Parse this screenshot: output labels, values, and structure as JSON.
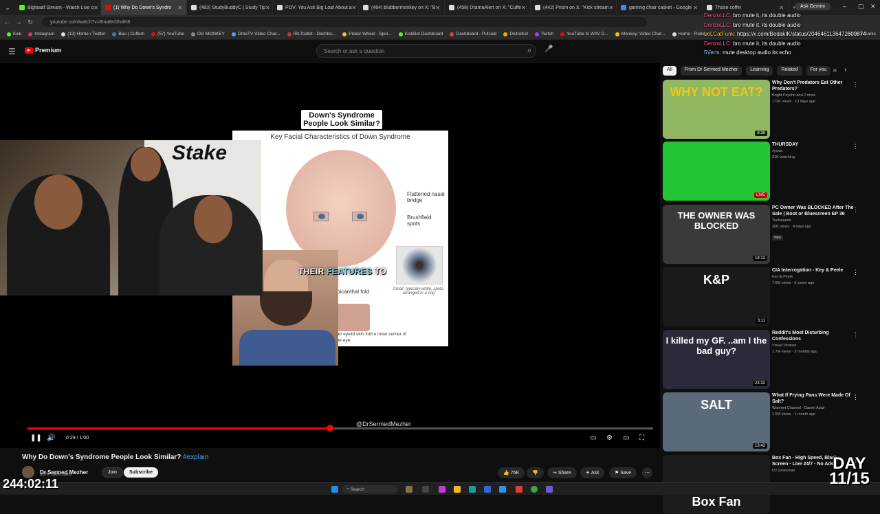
{
  "browser": {
    "tabs": [
      {
        "title": "Bigloaaf Stream - Watch Live o",
        "color": "#53fc18",
        "active": false
      },
      {
        "title": "(1) Why Do Down's Syndro",
        "color": "#ff0000",
        "active": true
      },
      {
        "title": "(483) StudyBuddyC | Study Tip",
        "color": "#dddddd",
        "active": false
      },
      {
        "title": "POV: You Ask Big Loaf About a",
        "color": "#dddddd",
        "active": false
      },
      {
        "title": "(464) blubbermonkey on X: \"B",
        "color": "#dddddd",
        "active": false
      },
      {
        "title": "(458) DramaAlert on X: \"Cuffe",
        "color": "#dddddd",
        "active": false
      },
      {
        "title": "(442) Prism on X: \"Kick stream",
        "color": "#dddddd",
        "active": false
      },
      {
        "title": "gaming chair casket - Google",
        "color": "#4285f4",
        "active": false
      },
      {
        "title": "Those coffin",
        "color": "#dddddd",
        "active": false
      }
    ],
    "ask_gemini": "Ask Gemini",
    "url": "youtube.com/watch?v=8ma8nDhnlK8",
    "bookmarks": [
      {
        "label": "Kick",
        "color": "#53fc18"
      },
      {
        "label": "Instagram",
        "color": "#e1306c"
      },
      {
        "label": "(12) Home / Twitter",
        "color": "#dddddd"
      },
      {
        "label": "Bau | Cuffem",
        "color": "#3a7bd5"
      },
      {
        "label": "(57) YouTube",
        "color": "#ff0000"
      },
      {
        "label": "OG MONKEY",
        "color": "#888888"
      },
      {
        "label": "OmeTV Video Chat...",
        "color": "#4aa3ff"
      },
      {
        "label": "IRLToolkit - Dashbo...",
        "color": "#cc3333"
      },
      {
        "label": "Picker Wheel - Spin...",
        "color": "#f5c518"
      },
      {
        "label": "KickBot Dashboard",
        "color": "#53fc18"
      },
      {
        "label": "Dashboard - Pulsoid",
        "color": "#e14040"
      },
      {
        "label": "DistroKid",
        "color": "#ffaa00"
      },
      {
        "label": "Twitch",
        "color": "#9146ff"
      },
      {
        "label": "YouTube to WAV D...",
        "color": "#ff0000"
      },
      {
        "label": "Monkey: Video Chat...",
        "color": "#f5c518"
      },
      {
        "label": "Home - Roblox",
        "color": "#dddddd"
      }
    ],
    "all_bookmarks": "All Bookmarks"
  },
  "youtube": {
    "logo": "Premium",
    "search_placeholder": "Search or ask a question"
  },
  "video": {
    "headline": "Down's Syndrome People Look Similar?",
    "card_subtitle": "Key Facial Characteristics of Down Syndrome",
    "labels": {
      "nasal": "Flattened nasal bridge",
      "brushfield": "Brushfield spots",
      "epicanthal": "picanthal fold",
      "iris_caption": "Small, typically white, spots, arranged in a ring",
      "eyelid": "per eyelid skin fold e inner corner of the eye."
    },
    "caption_white": "THEIR",
    "caption_highlight": "FEATURES",
    "caption_end": "TO",
    "handle": "@DrSermedMezher",
    "stake_logo": "Stake",
    "time": "0:29 / 1:00",
    "progress": 0.483,
    "title": "Why Do Down's Syndrome People Look Similar?",
    "hashtag": "#explain",
    "channel": "Dr Sermed Mezher",
    "subs": "867K subscribers",
    "join": "Join",
    "subscribe": "Subscribe",
    "likes": "76K",
    "share": "Share",
    "ask": "Ask",
    "save": "Save"
  },
  "chips": [
    "All",
    "From Dr Sermed Mezher",
    "Learning",
    "Related",
    "For you"
  ],
  "chip_overflow": "R",
  "recommendations": [
    {
      "title": "Why Don't Predators Eat Other Predators?",
      "channel": "Bright Psycho and 2 more",
      "meta": "172K views · 13 days ago",
      "duration": "9:39",
      "thumb_text": "WHY NOT EAT?",
      "bg": "#8fb860",
      "fg": "#f5c518"
    },
    {
      "title": "THURSDAY",
      "channel": "Jynxzi",
      "meta": "21K watching",
      "duration": "LIVE",
      "thumb_text": "",
      "bg": "#22c634",
      "fg": "#ffffff"
    },
    {
      "title": "PC Owner Was BLOCKED After The Sale | Boot or Bluescreen EP 36",
      "channel": "Techwando",
      "meta": "20K views · 4 days ago",
      "duration": "18:12",
      "thumb_text": "THE OWNER WAS BLOCKED",
      "bg": "#3a3a3a",
      "fg": "#ffffff",
      "badge": "New"
    },
    {
      "title": "CIA Interrogation - Key & Peele",
      "channel": "Key & Peele",
      "meta": "7.6M views · 5 years ago",
      "duration": "3:11",
      "thumb_text": "K&P",
      "bg": "#1a1a1a",
      "fg": "#ffffff"
    },
    {
      "title": "Reddit's Most Disturbing Confessions",
      "channel": "Visual Venture",
      "meta": "1.7M views · 3 months ago",
      "duration": "23:32",
      "thumb_text": "I killed my GF. ..am I the bad guy?",
      "bg": "#2a2a3a",
      "fg": "#ffffff"
    },
    {
      "title": "What If Frying Pans Were Made Of Salt?",
      "channel": "Waterjet Channel - Daniel Adair",
      "meta": "1.5M views · 1 month ago",
      "duration": "13:42",
      "thumb_text": "SALT",
      "bg": "#5a6a78",
      "fg": "#ffffff"
    },
    {
      "title": "Box Fan - High Speed, Black Screen · Live 24/7 · No Ads",
      "channel": "DJ Grossman",
      "meta": "",
      "duration": "",
      "thumb_text": "Box Fan",
      "bg": "#1c1c1c",
      "fg": "#ffffff"
    }
  ],
  "chat": [
    {
      "user": "DenzoLLC:",
      "msg": "bro mute it, its double audio",
      "color": "#ff5a8c"
    },
    {
      "user": "DenzoLLC:",
      "msg": "bro mute it, its double audio",
      "color": "#ff5a8c"
    },
    {
      "user": "LoLCatFunk:",
      "msg": "https://x.com/BodakIK/status/2046461136472600874",
      "color": "#ffcc33"
    },
    {
      "user": "DenzoLLC:",
      "msg": "bro mute it, its double audio",
      "color": "#ff5a8c"
    },
    {
      "user": "5Verts:",
      "msg": "mute desktop audio its echo",
      "color": "#8cd3ff"
    }
  ],
  "overlay": {
    "day_line1": "DAY",
    "day_line2": "11/15",
    "uptime": "244:02:11"
  },
  "taskbar": {
    "search": "Search"
  }
}
